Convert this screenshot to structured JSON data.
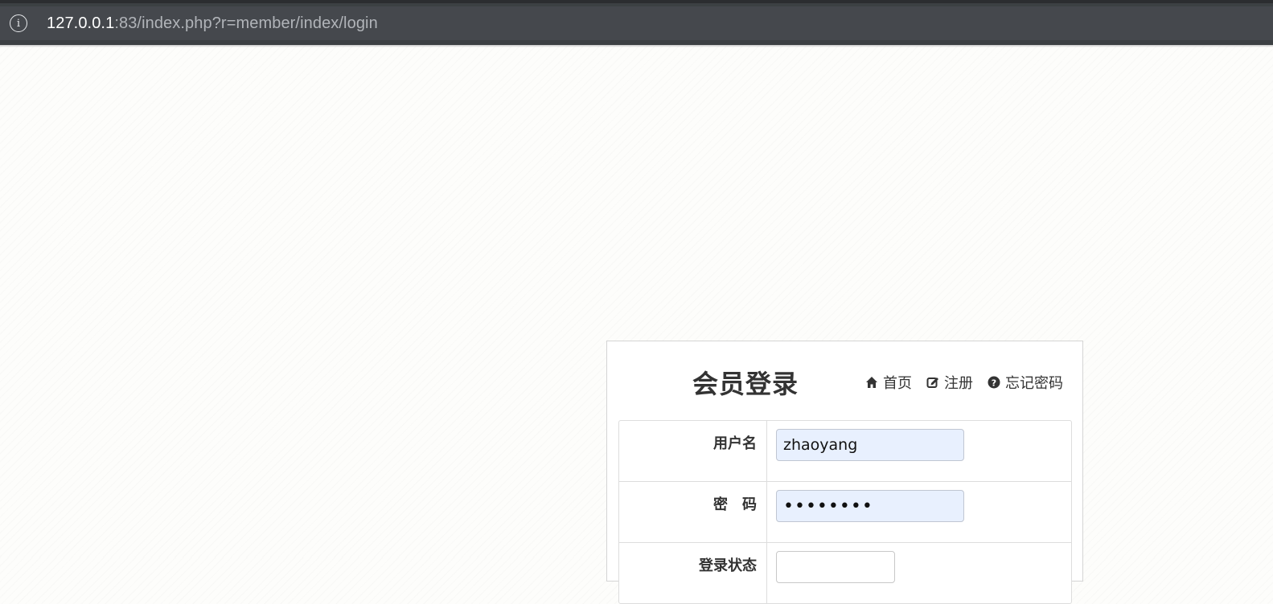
{
  "browser": {
    "url_host": "127.0.0.1",
    "url_path": ":83/index.php?r=member/index/login",
    "info_icon": "info-icon"
  },
  "login": {
    "title": "会员登录",
    "links": {
      "home": "首页",
      "register": "注册",
      "forgot": "忘记密码"
    },
    "fields": {
      "username_label": "用户名",
      "username_value": "zhaoyang",
      "password_label": "密　码",
      "password_value": "••••••••",
      "status_label": "登录状态"
    }
  }
}
